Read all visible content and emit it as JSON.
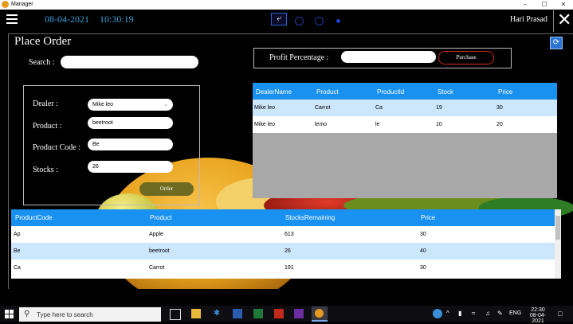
{
  "window": {
    "title": "Manager"
  },
  "header": {
    "date": "08-04-2021",
    "time": "10:30:19",
    "user": "Hari Prasad"
  },
  "page": {
    "title": "Place Order",
    "search_label": "Search :",
    "search_value": "",
    "profit_label": "Profit Percentage :",
    "profit_value": "",
    "purchase_label": "Purchase"
  },
  "form": {
    "dealer_label": "Dealer :",
    "dealer_value": "Mike leo",
    "product_label": "Product :",
    "product_value": "beetroot",
    "code_label": "Product Code :",
    "code_value": "Be",
    "stocks_label": "Stocks :",
    "stocks_value": "26",
    "order_label": "Order"
  },
  "dealer_grid": {
    "headers": [
      "DealerName",
      "Product",
      "ProductId",
      "Stock",
      "Price"
    ],
    "rows": [
      [
        "Mike leo",
        "Carrot",
        "Ca",
        "19",
        "30"
      ],
      [
        "Mike leo",
        "lemo",
        "le",
        "10",
        "20"
      ]
    ]
  },
  "stock_grid": {
    "headers": [
      "ProductCode",
      "Product",
      "StocksRemaining",
      "Price"
    ],
    "rows": [
      [
        "Ap",
        "Apple",
        "613",
        "30"
      ],
      [
        "Be",
        "beetroot",
        "26",
        "40"
      ],
      [
        "Ca",
        "Carrot",
        "191",
        "30"
      ]
    ]
  },
  "taskbar": {
    "search_placeholder": "Type here to search",
    "lang": "ENG",
    "clock_time": "22:30",
    "clock_date": "08-04-2021"
  },
  "colors": {
    "accent": "#1991f0",
    "selected_row": "#cce6fb",
    "purchase_border": "#c72a1c"
  }
}
